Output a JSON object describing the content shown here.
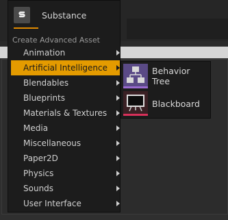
{
  "top_item": {
    "icon": "substance-icon",
    "label": "Substance"
  },
  "section_header": "Create Advanced Asset",
  "menu": {
    "items": [
      {
        "label": "Animation",
        "selected": false
      },
      {
        "label": "Artificial Intelligence",
        "selected": true
      },
      {
        "label": "Blendables",
        "selected": false
      },
      {
        "label": "Blueprints",
        "selected": false
      },
      {
        "label": "Materials & Textures",
        "selected": false
      },
      {
        "label": "Media",
        "selected": false
      },
      {
        "label": "Miscellaneous",
        "selected": false
      },
      {
        "label": "Paper2D",
        "selected": false
      },
      {
        "label": "Physics",
        "selected": false
      },
      {
        "label": "Sounds",
        "selected": false
      },
      {
        "label": "User Interface",
        "selected": false
      }
    ]
  },
  "submenu": {
    "items": [
      {
        "label": "Behavior Tree",
        "icon": "behavior-tree-icon",
        "accent": "#9a6bd0"
      },
      {
        "label": "Blackboard",
        "icon": "blackboard-icon",
        "accent": "#d8305a"
      }
    ]
  },
  "colors": {
    "selection": "#e49b00",
    "menu_bg": "#1c1c1c"
  }
}
